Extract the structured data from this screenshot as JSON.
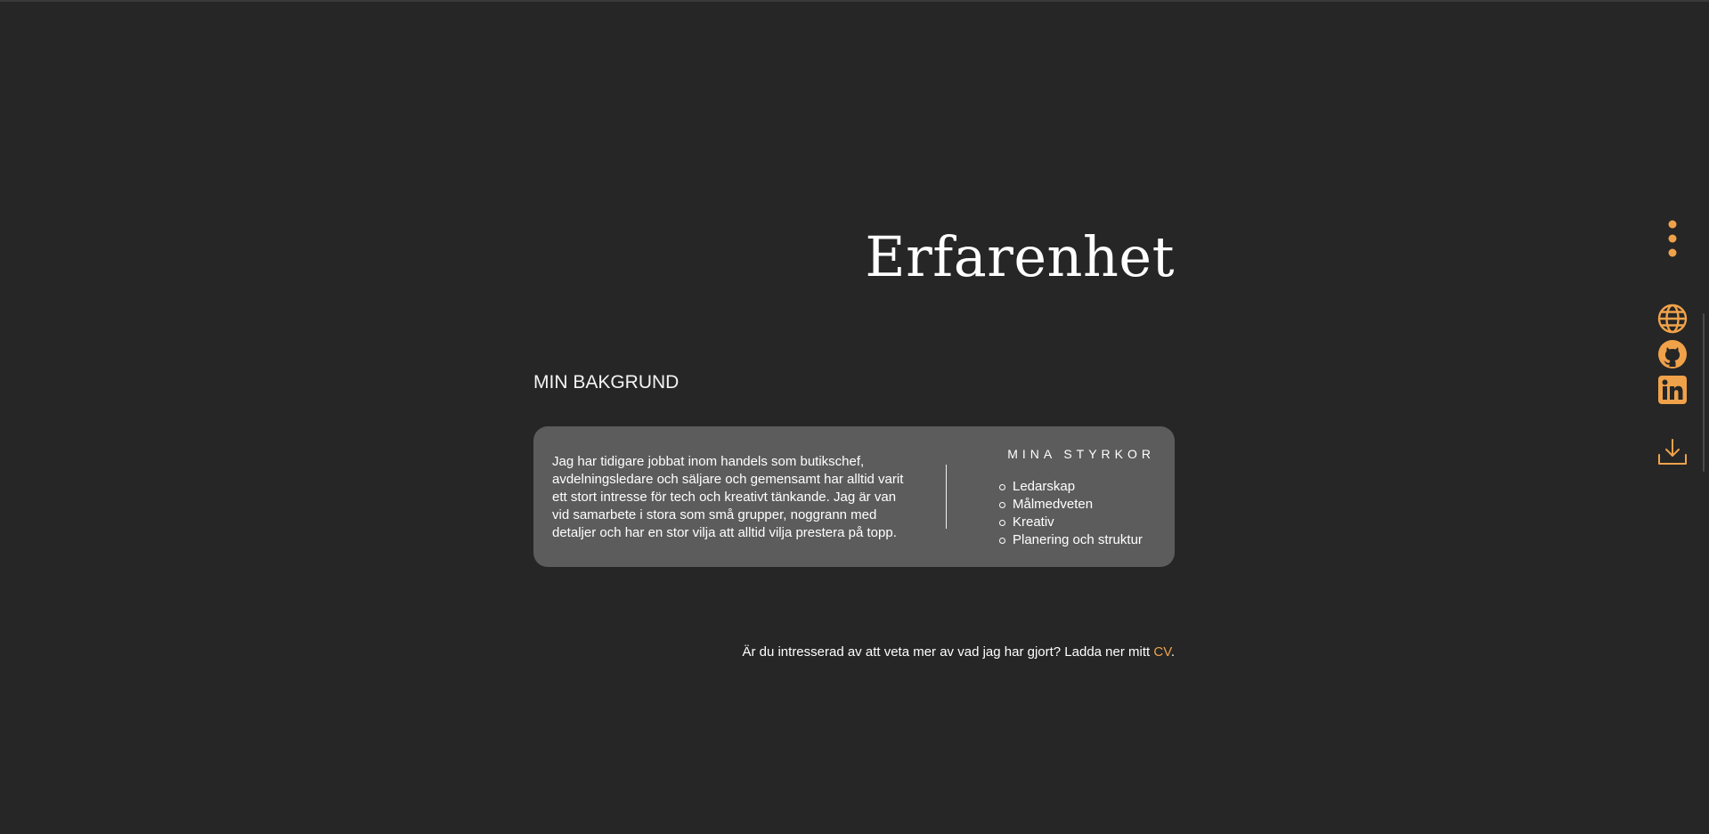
{
  "page": {
    "title": "Erfarenhet"
  },
  "background_section": {
    "heading": "MIN BAKGRUND",
    "description": "Jag har tidigare jobbat inom handels som butikschef, avdelningsledare och säljare och gemensamt har alltid varit ett stort intresse för tech och kreativt tänkande. Jag är van vid samarbete i stora som små grupper, noggrann med detaljer och har en stor vilja att alltid vilja prestera på topp.",
    "strengths_title": "MINA STYRKOR",
    "strengths": [
      "Ledarskap",
      "Målmedveten",
      "Kreativ",
      "Planering och struktur"
    ]
  },
  "cta": {
    "text": "Är du intresserad av att veta mer av vad jag har gjort? Ladda ner mitt ",
    "link_label": "CV",
    "suffix": "."
  },
  "sidebar": {
    "icons": [
      "more-vertical-icon",
      "globe-icon",
      "github-icon",
      "linkedin-icon",
      "download-icon"
    ]
  },
  "colors": {
    "background": "#262626",
    "card": "#5c5c5c",
    "accent": "#f0a24a"
  }
}
